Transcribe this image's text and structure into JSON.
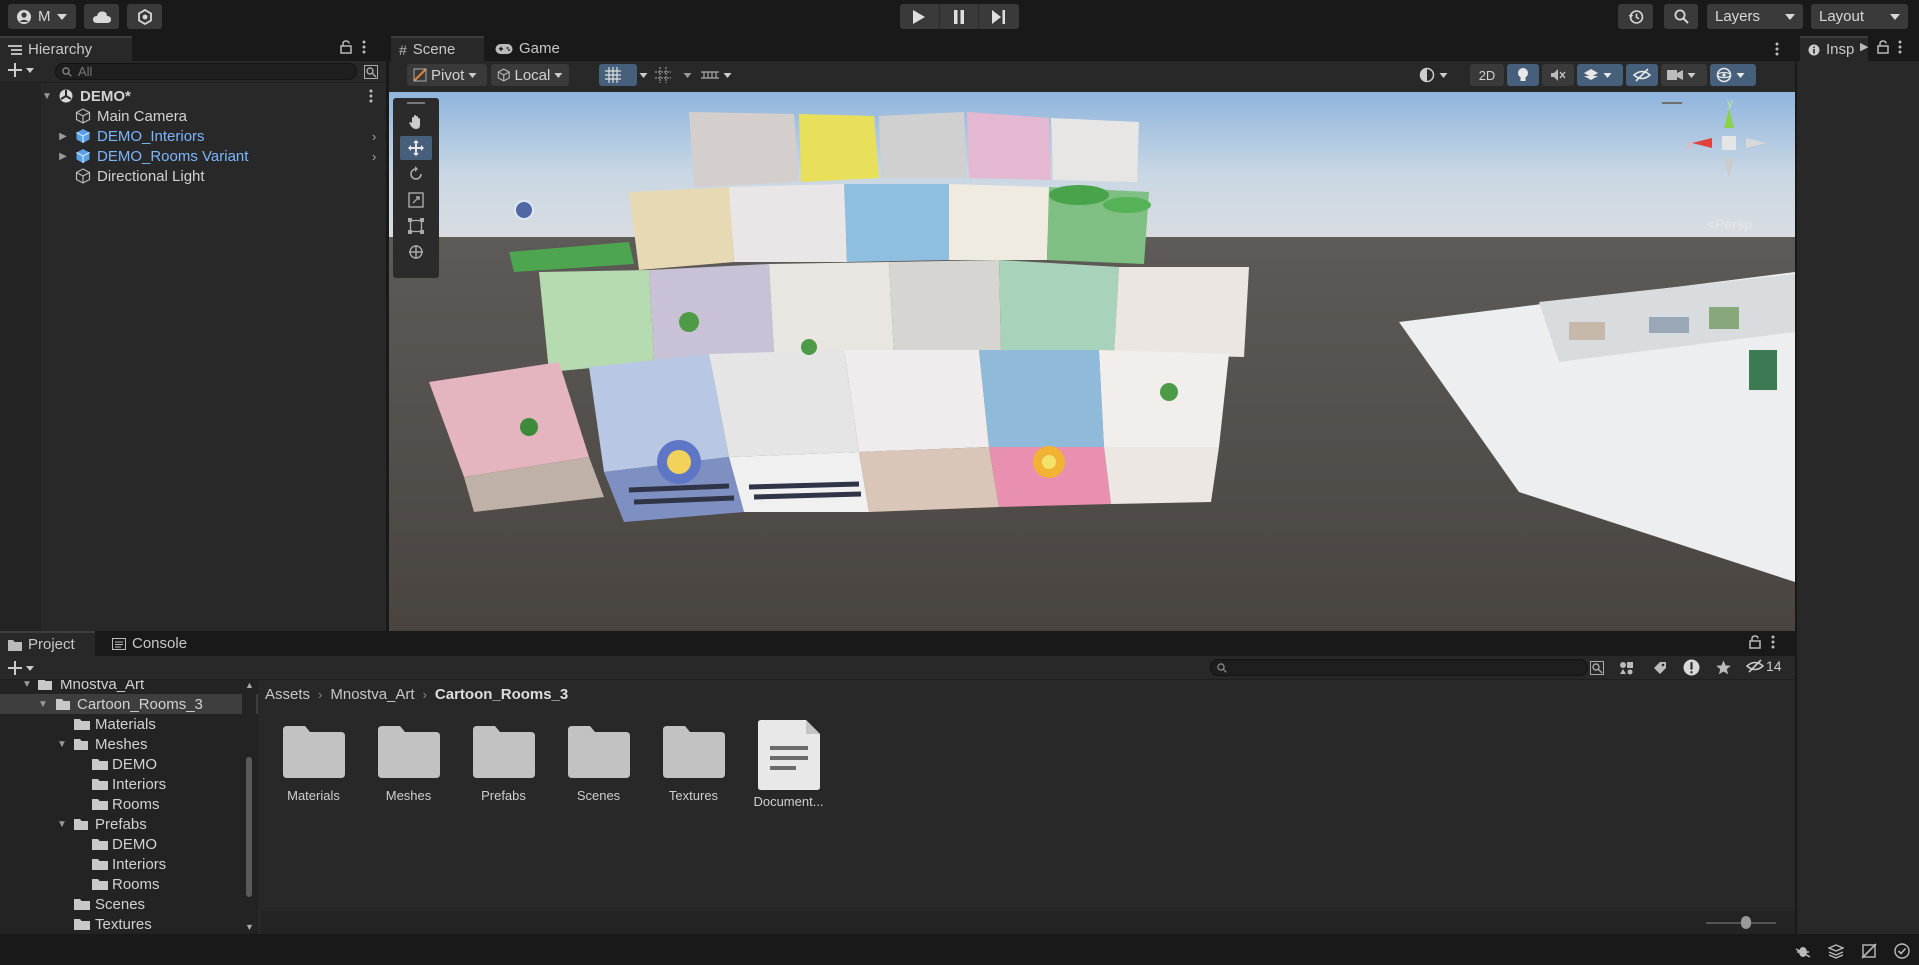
{
  "toolbar": {
    "account_label": "M",
    "layers_label": "Layers",
    "layout_label": "Layout"
  },
  "hierarchy": {
    "tab_label": "Hierarchy",
    "search_placeholder": "All",
    "items": [
      {
        "label": "DEMO*",
        "type": "scene"
      },
      {
        "label": "Main Camera",
        "type": "gameobject"
      },
      {
        "label": "DEMO_Interiors",
        "type": "prefab"
      },
      {
        "label": "DEMO_Rooms Variant",
        "type": "prefab"
      },
      {
        "label": "Directional Light",
        "type": "gameobject"
      }
    ]
  },
  "scene": {
    "tabs": [
      {
        "label": "Scene"
      },
      {
        "label": "Game"
      }
    ],
    "pivot_label": "Pivot",
    "local_label": "Local",
    "mode_2d_label": "2D",
    "persp_label": "<Persp",
    "gizmo_y": "y",
    "gizmo_x": "x"
  },
  "inspector": {
    "tab_label": "Insp"
  },
  "project": {
    "tabs": [
      {
        "label": "Project"
      },
      {
        "label": "Console"
      }
    ],
    "hidden_count": "14",
    "tree": [
      {
        "label": "Mnostva_Art",
        "depth": 0
      },
      {
        "label": "Cartoon_Rooms_3",
        "depth": 1
      },
      {
        "label": "Materials",
        "depth": 2
      },
      {
        "label": "Meshes",
        "depth": 2
      },
      {
        "label": "DEMO",
        "depth": 3
      },
      {
        "label": "Interiors",
        "depth": 3
      },
      {
        "label": "Rooms",
        "depth": 3
      },
      {
        "label": "Prefabs",
        "depth": 2
      },
      {
        "label": "DEMO",
        "depth": 3
      },
      {
        "label": "Interiors",
        "depth": 3
      },
      {
        "label": "Rooms",
        "depth": 3
      },
      {
        "label": "Scenes",
        "depth": 2
      },
      {
        "label": "Textures",
        "depth": 2
      }
    ],
    "breadcrumb": [
      "Assets",
      "Mnostva_Art",
      "Cartoon_Rooms_3"
    ],
    "assets": [
      {
        "label": "Materials",
        "kind": "folder"
      },
      {
        "label": "Meshes",
        "kind": "folder"
      },
      {
        "label": "Prefabs",
        "kind": "folder"
      },
      {
        "label": "Scenes",
        "kind": "folder"
      },
      {
        "label": "Textures",
        "kind": "folder"
      },
      {
        "label": "Document...",
        "kind": "document"
      }
    ]
  },
  "colors": {
    "accent": "#46607c",
    "prefab": "#7bb6ff",
    "panel": "#282828",
    "frame": "#191919"
  }
}
